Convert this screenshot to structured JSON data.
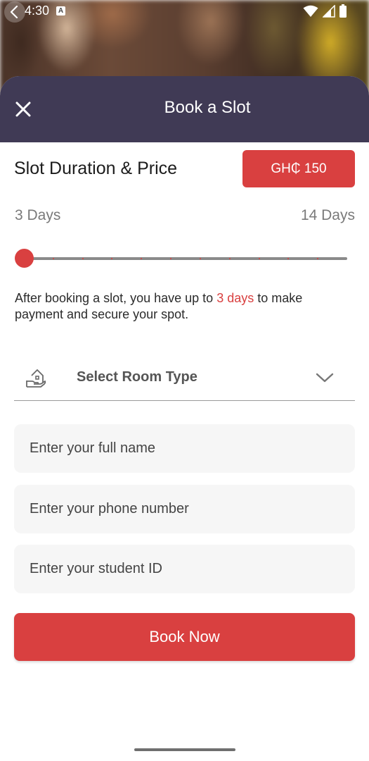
{
  "status_bar": {
    "time": "4:30",
    "notification_badge": "A",
    "icons": [
      "wifi-icon",
      "signal-icon",
      "battery-icon"
    ]
  },
  "sheet": {
    "title": "Book a Slot",
    "header_color": "#403a55"
  },
  "duration": {
    "section_title": "Slot Duration & Price",
    "price_label": "GH₵ 150",
    "min_label": "3 Days",
    "max_label": "14 Days",
    "slider_value_days": 3,
    "slider_min_days": 3,
    "slider_max_days": 14,
    "info_prefix": "After booking a slot, you have up to ",
    "info_highlight": "3 days",
    "info_suffix": " to make payment and secure your spot."
  },
  "room_type": {
    "label": "Select Room Type",
    "icon": "house-hand-icon"
  },
  "form": {
    "full_name_placeholder": "Enter your full name",
    "phone_placeholder": "Enter your phone number",
    "student_id_placeholder": "Enter your student ID"
  },
  "actions": {
    "book_label": "Book Now"
  },
  "colors": {
    "accent": "#d94040",
    "header": "#403a55",
    "field_bg": "#f6f6f6"
  }
}
